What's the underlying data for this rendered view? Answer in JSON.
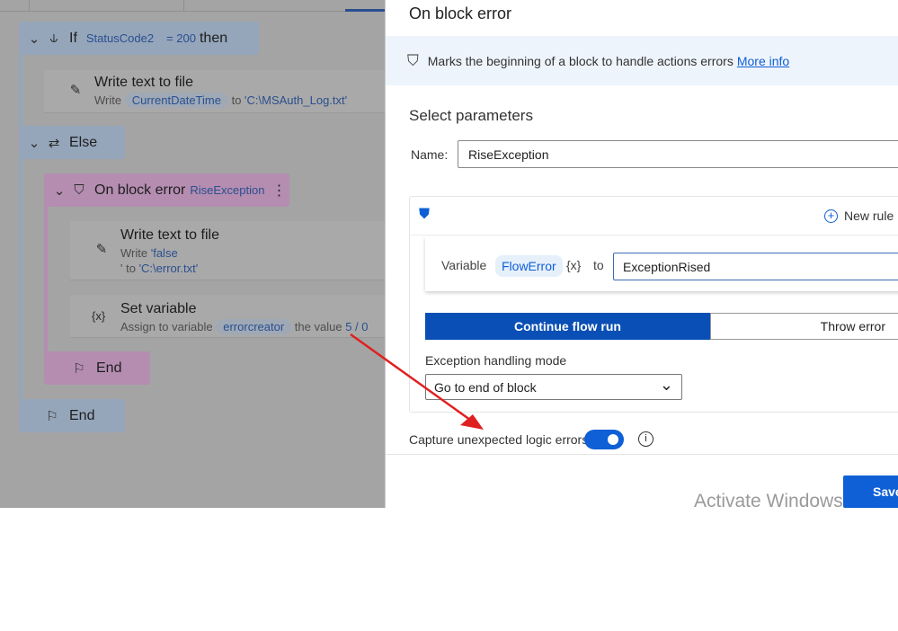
{
  "flow": {
    "if_block": {
      "keyword": "If",
      "variable": "StatusCode2",
      "operator": "= 200",
      "then": "then"
    },
    "write1": {
      "title": "Write text to file",
      "prefix": "Write",
      "variable": "CurrentDateTime",
      "suffix": "to",
      "path": "'C:\\MSAuth_Log.txt'"
    },
    "else_block": {
      "keyword": "Else"
    },
    "on_error": {
      "title": "On block error",
      "name": "RiseException"
    },
    "write2": {
      "title": "Write text to file",
      "prefix": "Write",
      "value": "'false",
      "line2_prefix": "' to",
      "path": "'C:\\error.txt'"
    },
    "setvar": {
      "title": "Set variable",
      "prefix": "Assign to variable",
      "variable": "errorcreator",
      "mid": "the value",
      "value": "5 / 0"
    },
    "end_inner": "End",
    "end_outer": "End"
  },
  "panel": {
    "title": "On block error",
    "info_text": "Marks the beginning of a block to handle actions errors",
    "info_link": "More info",
    "section_title": "Select parameters",
    "name_label": "Name:",
    "name_value": "RiseException",
    "new_rule": "New rule",
    "variable_label": "Variable",
    "variable_pill": "FlowError",
    "var_icon": "{x}",
    "to_label": "to",
    "variable_value": "ExceptionRised",
    "mode_buttons": [
      {
        "label": "Continue flow run",
        "selected": true
      },
      {
        "label": "Throw error",
        "selected": false
      }
    ],
    "exception_mode_label": "Exception handling mode",
    "exception_mode_value": "Go to end of block",
    "capture_label": "Capture unexpected logic errors",
    "capture_enabled": true,
    "save_label": "Save",
    "watermark": "Activate Windows"
  },
  "colors": {
    "accent": "#0f5fd6",
    "selected_segment": "#0a4fb5",
    "annotation_arrow": "#e02020"
  }
}
